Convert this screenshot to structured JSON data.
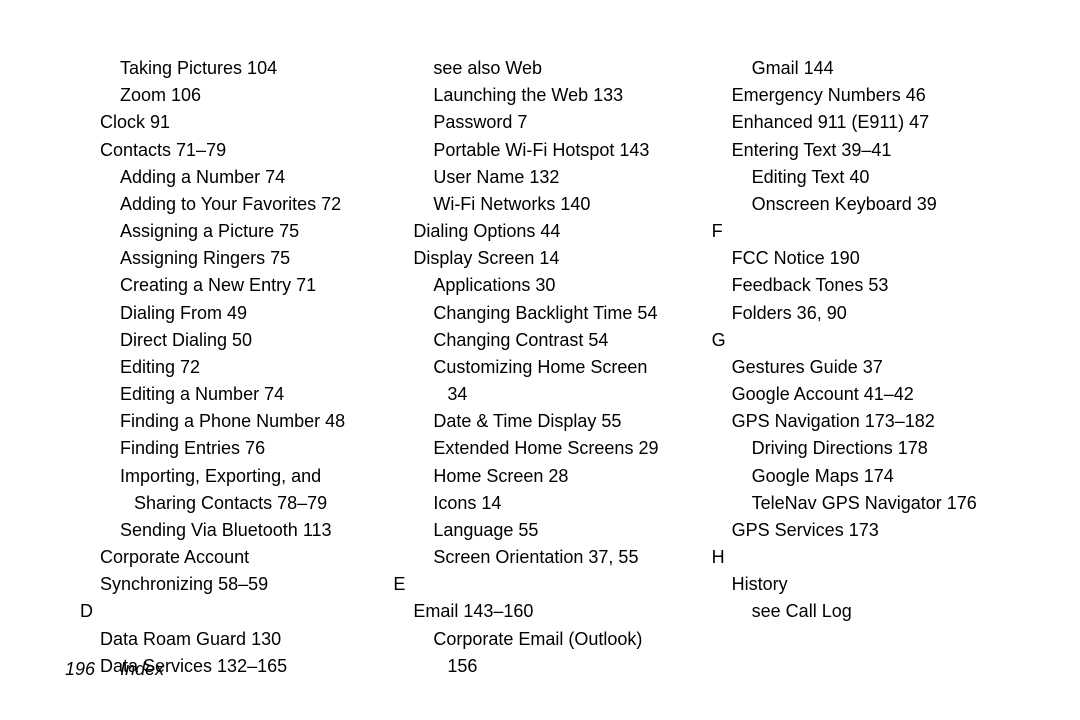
{
  "footer": {
    "page": "196",
    "title": "Index"
  },
  "col1": [
    {
      "cls": "i2",
      "t": "Taking Pictures 104"
    },
    {
      "cls": "i2",
      "t": "Zoom 106"
    },
    {
      "cls": "i1",
      "t": "Clock 91"
    },
    {
      "cls": "i1",
      "t": "Contacts 71–79"
    },
    {
      "cls": "i2",
      "t": "Adding a Number 74"
    },
    {
      "cls": "i2",
      "t": "Adding to Your Favorites 72"
    },
    {
      "cls": "i2",
      "t": "Assigning a Picture 75"
    },
    {
      "cls": "i2",
      "t": "Assigning Ringers 75"
    },
    {
      "cls": "i2",
      "t": "Creating a New Entry 71"
    },
    {
      "cls": "i2",
      "t": "Dialing From 49"
    },
    {
      "cls": "i2",
      "t": "Direct Dialing 50"
    },
    {
      "cls": "i2",
      "t": "Editing 72"
    },
    {
      "cls": "i2",
      "t": "Editing a Number 74"
    },
    {
      "cls": "i2",
      "t": "Finding a Phone Number 48"
    },
    {
      "cls": "i2",
      "t": "Finding Entries 76"
    },
    {
      "cls": "i2",
      "t": "Importing, Exporting, and"
    },
    {
      "cls": "i3",
      "t": "Sharing Contacts 78–79"
    },
    {
      "cls": "i2",
      "t": "Sending Via Bluetooth 113"
    },
    {
      "cls": "i1",
      "t": "Corporate Account"
    },
    {
      "cls": "i1",
      "t": " Synchronizing 58–59"
    },
    {
      "cls": "letter",
      "t": "D"
    },
    {
      "cls": "i1",
      "t": "Data Roam Guard 130"
    },
    {
      "cls": "i1",
      "t": "Data Services 132–165"
    }
  ],
  "col2": [
    {
      "cls": "i2",
      "t": "see also Web"
    },
    {
      "cls": "i2",
      "t": "Launching the Web 133"
    },
    {
      "cls": "i2",
      "t": "Password 7"
    },
    {
      "cls": "i2",
      "t": "Portable Wi-Fi Hotspot 143"
    },
    {
      "cls": "i2",
      "t": "User Name 132"
    },
    {
      "cls": "i2",
      "t": "Wi-Fi Networks 140"
    },
    {
      "cls": "i1",
      "t": "Dialing Options 44"
    },
    {
      "cls": "i1",
      "t": "Display Screen 14"
    },
    {
      "cls": "i2",
      "t": "Applications 30"
    },
    {
      "cls": "i2",
      "t": "Changing Backlight Time 54"
    },
    {
      "cls": "i2",
      "t": "Changing Contrast 54"
    },
    {
      "cls": "i2",
      "t": "Customizing Home Screen"
    },
    {
      "cls": "i3",
      "t": "34"
    },
    {
      "cls": "i2",
      "t": "Date & Time Display 55"
    },
    {
      "cls": "i2",
      "t": "Extended Home Screens 29"
    },
    {
      "cls": "i2",
      "t": "Home Screen 28"
    },
    {
      "cls": "i2",
      "t": "Icons 14"
    },
    {
      "cls": "i2",
      "t": "Language 55"
    },
    {
      "cls": "i2",
      "t": "Screen Orientation 37, 55"
    },
    {
      "cls": "letter",
      "t": "E"
    },
    {
      "cls": "i1",
      "t": "Email 143–160"
    },
    {
      "cls": "i2",
      "t": "Corporate Email (Outlook)"
    },
    {
      "cls": "i3",
      "t": "156"
    }
  ],
  "col3": [
    {
      "cls": "i2",
      "t": "Gmail 144"
    },
    {
      "cls": "i1",
      "t": "Emergency Numbers 46"
    },
    {
      "cls": "i1",
      "t": "Enhanced 911 (E911) 47"
    },
    {
      "cls": "i1",
      "t": "Entering Text 39–41"
    },
    {
      "cls": "i2",
      "t": "Editing Text 40"
    },
    {
      "cls": "i2",
      "t": "Onscreen Keyboard 39"
    },
    {
      "cls": "letter",
      "t": "F"
    },
    {
      "cls": "i1",
      "t": "FCC Notice 190"
    },
    {
      "cls": "i1",
      "t": "Feedback Tones 53"
    },
    {
      "cls": "i1",
      "t": "Folders 36, 90"
    },
    {
      "cls": "letter",
      "t": "G"
    },
    {
      "cls": "i1",
      "t": "Gestures Guide 37"
    },
    {
      "cls": "i1",
      "t": "Google Account 41–42"
    },
    {
      "cls": "i1",
      "t": "GPS Navigation 173–182"
    },
    {
      "cls": "i2",
      "t": "Driving Directions 178"
    },
    {
      "cls": "i2",
      "t": "Google Maps 174"
    },
    {
      "cls": "i2",
      "t": "TeleNav GPS Navigator 176"
    },
    {
      "cls": "i1",
      "t": "GPS Services 173"
    },
    {
      "cls": "letter",
      "t": "H"
    },
    {
      "cls": "i1",
      "t": "History"
    },
    {
      "cls": "i2",
      "t": "see Call Log"
    }
  ]
}
